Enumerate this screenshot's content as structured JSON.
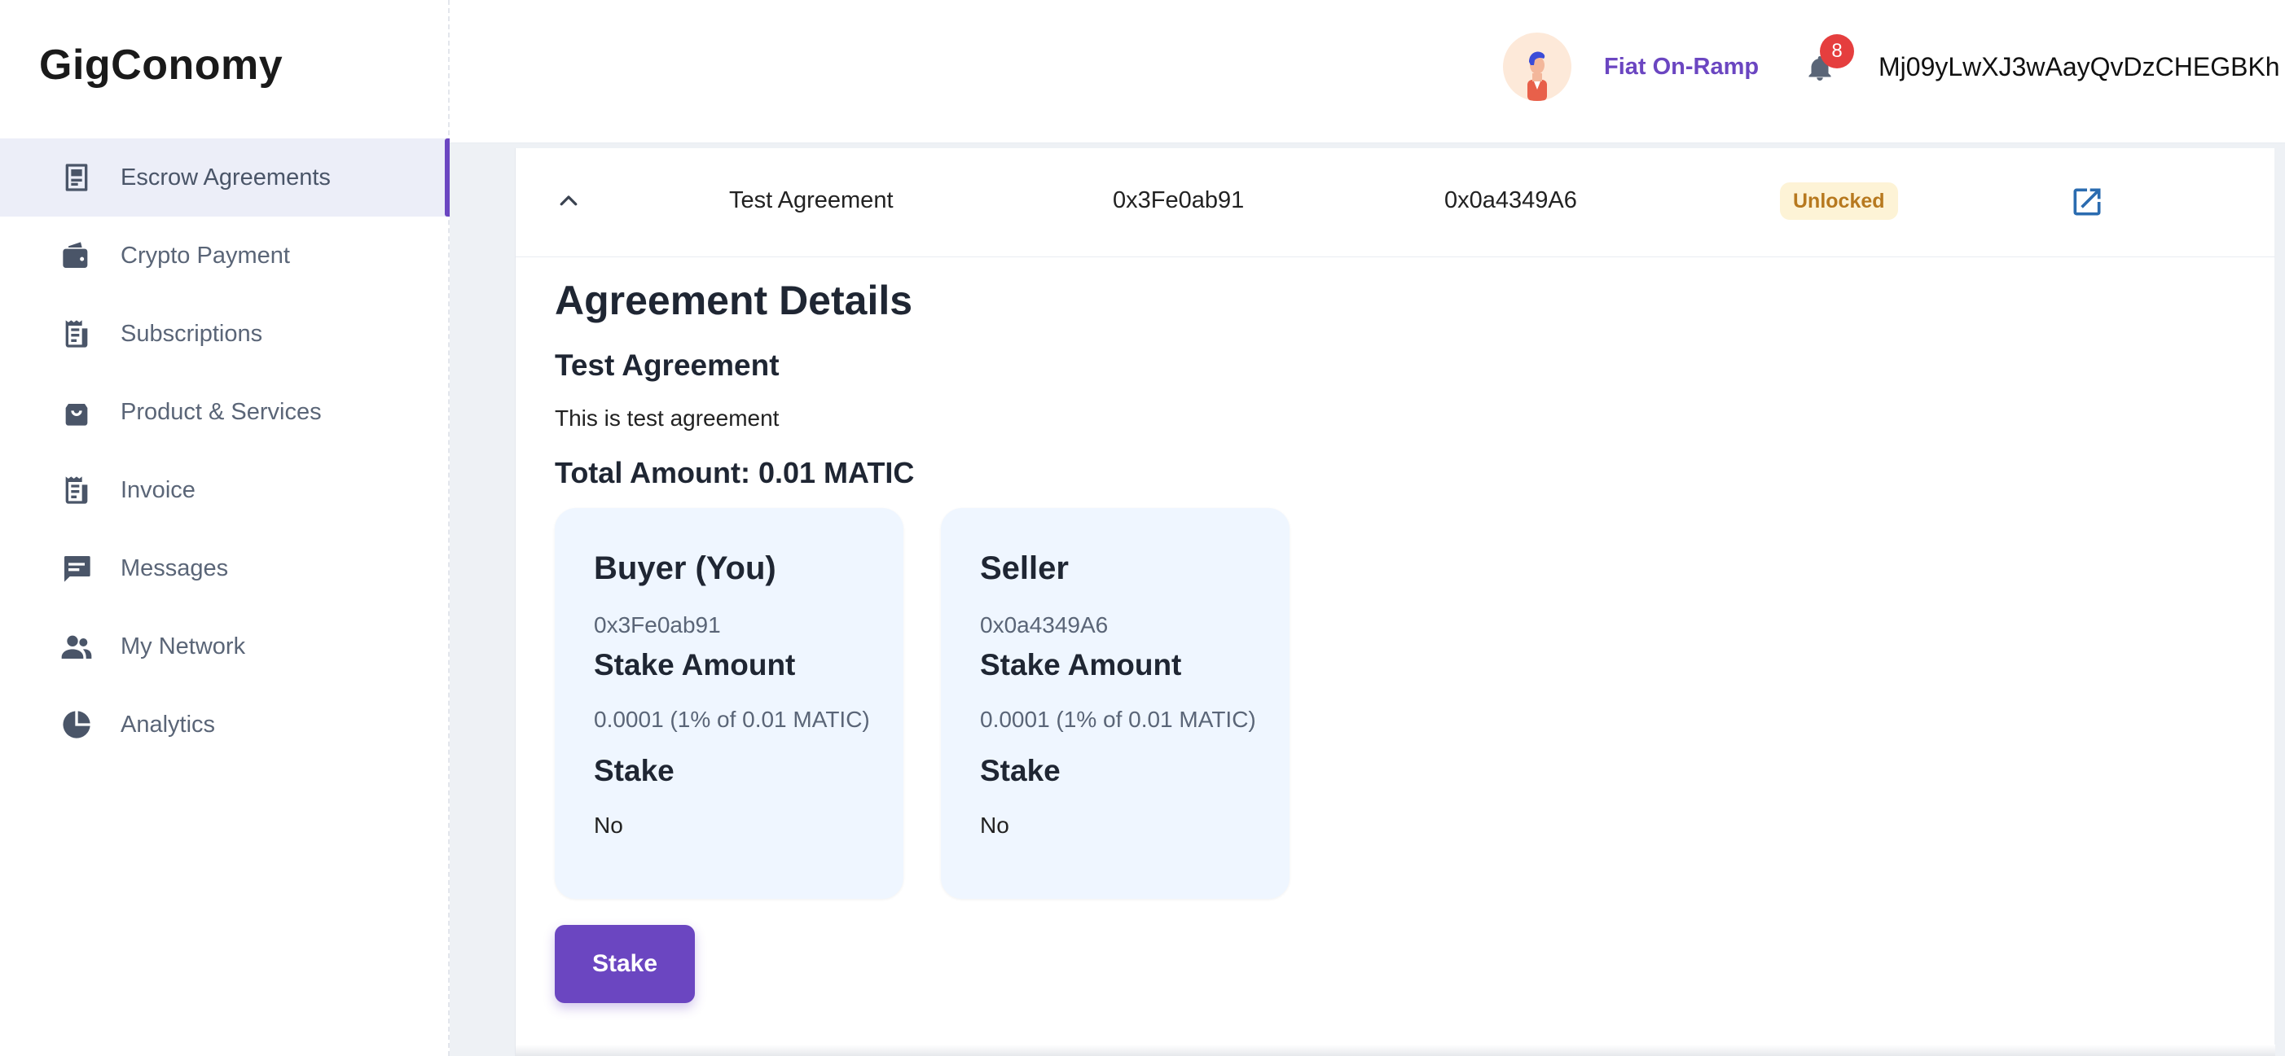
{
  "app": {
    "logo": "GigConomy"
  },
  "sidebar": {
    "items": [
      {
        "label": "Escrow Agreements",
        "icon": "document-icon",
        "active": true
      },
      {
        "label": "Crypto Payment",
        "icon": "wallet-icon"
      },
      {
        "label": "Subscriptions",
        "icon": "receipt-icon"
      },
      {
        "label": "Product & Services",
        "icon": "shopping-bag-icon"
      },
      {
        "label": "Invoice",
        "icon": "receipt-icon"
      },
      {
        "label": "Messages",
        "icon": "chat-icon"
      },
      {
        "label": "My Network",
        "icon": "people-icon"
      },
      {
        "label": "Analytics",
        "icon": "pie-chart-icon"
      }
    ]
  },
  "header": {
    "fiat_label": "Fiat On-Ramp",
    "notification_count": "8",
    "wallet_address": "Mj09yLwXJ3wAayQvDzCHEGBKh"
  },
  "agreement_row": {
    "name": "Test Agreement",
    "buyer_address": "0x3Fe0ab91",
    "seller_address": "0x0a4349A6",
    "status": "Unlocked"
  },
  "details": {
    "title": "Agreement Details",
    "name": "Test Agreement",
    "description": "This is test agreement",
    "total": "Total Amount: 0.01 MATIC",
    "buyer": {
      "title": "Buyer (You)",
      "address": "0x3Fe0ab91",
      "stake_amount_label": "Stake Amount",
      "stake_amount": "0.0001 (1% of 0.01 MATIC)",
      "stake_label": "Stake",
      "stake": "No"
    },
    "seller": {
      "title": "Seller",
      "address": "0x0a4349A6",
      "stake_amount_label": "Stake Amount",
      "stake_amount": "0.0001 (1% of 0.01 MATIC)",
      "stake_label": "Stake",
      "stake": "No"
    },
    "stake_button": "Stake"
  },
  "colors": {
    "accent": "#6b46c1",
    "badge": "#e53e3e",
    "status_bg": "#fdf3d6",
    "status_text": "#b7791f",
    "card_bg": "#eff6ff",
    "link_icon": "#2b6cb0"
  }
}
